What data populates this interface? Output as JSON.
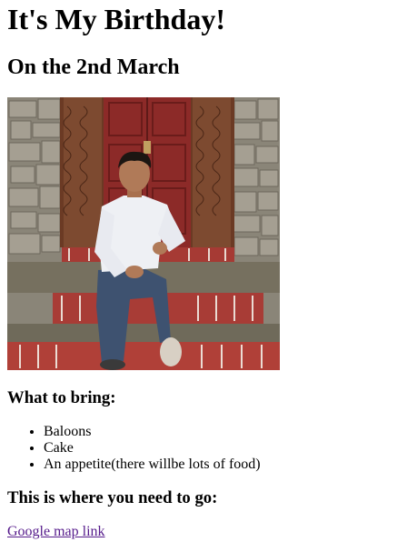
{
  "page": {
    "title": "It's My Birthday!",
    "subtitle": "On the 2nd March"
  },
  "bring": {
    "heading": "What to bring:",
    "items": [
      "Baloons",
      "Cake",
      "An appetite(there willbe lots of food)"
    ]
  },
  "location": {
    "heading": "This is where you need to go:",
    "link_text": "Google map link"
  },
  "colors": {
    "visited_link": "#551a8b",
    "text": "#000000",
    "background": "#ffffff"
  }
}
